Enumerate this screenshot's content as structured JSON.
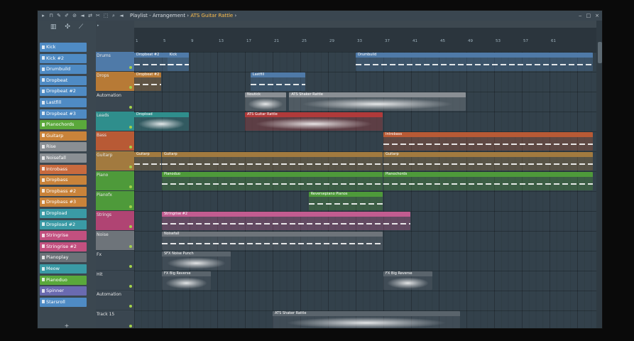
{
  "titlebar": {
    "title_prefix": "Playlist - Arrangement",
    "sep": "›",
    "current_pattern": "ATS Guitar Rattle",
    "min": "‒",
    "max": "□",
    "close": "×"
  },
  "browser": {
    "patterns": [
      {
        "label": "Kick",
        "color": "#4f8bc4"
      },
      {
        "label": "Kick #2",
        "color": "#4f8bc4"
      },
      {
        "label": "Drumbuild",
        "color": "#4f8bc4"
      },
      {
        "label": "Dropbeat",
        "color": "#4f8bc4"
      },
      {
        "label": "Dropbeat #2",
        "color": "#4f8bc4"
      },
      {
        "label": "Lastfill",
        "color": "#4f8bc4"
      },
      {
        "label": "Dropbeat #3",
        "color": "#4f8bc4"
      },
      {
        "label": "Pianochords",
        "color": "#5aa83b"
      },
      {
        "label": "Guitarp",
        "color": "#c9833a"
      },
      {
        "label": "Rise",
        "color": "#8a8f94"
      },
      {
        "label": "Noisefall",
        "color": "#8a8f94"
      },
      {
        "label": "Introbass",
        "color": "#c86a3e"
      },
      {
        "label": "Dropbass",
        "color": "#c9833a"
      },
      {
        "label": "Dropbass #2",
        "color": "#c9833a"
      },
      {
        "label": "Dropbass #3",
        "color": "#c9833a"
      },
      {
        "label": "Dropload",
        "color": "#3a9aa5"
      },
      {
        "label": "Dropload #2",
        "color": "#3a9aa5"
      },
      {
        "label": "Stringrise",
        "color": "#c2507f"
      },
      {
        "label": "Stringrise #2",
        "color": "#c2507f"
      },
      {
        "label": "Pianoplay",
        "color": "#6b7278"
      },
      {
        "label": "Meow",
        "color": "#3a9aa5"
      },
      {
        "label": "Pianoduo",
        "color": "#5aa83b"
      },
      {
        "label": "Spinner",
        "color": "#6a6ab0"
      },
      {
        "label": "Starsroll",
        "color": "#4f8bc4"
      }
    ],
    "add_label": "+"
  },
  "tracks": [
    {
      "label": "Drums",
      "color": "#4f7aa8"
    },
    {
      "label": "Drops",
      "color": "#b77a36"
    },
    {
      "label": "Automation",
      "color": "#3a4650"
    },
    {
      "label": "Leads",
      "color": "#2f8e8c"
    },
    {
      "label": "Bass",
      "color": "#b85a35"
    },
    {
      "label": "Guitarp",
      "color": "#a27a3f"
    },
    {
      "label": "Piano",
      "color": "#4e9a3a"
    },
    {
      "label": "Pianofx",
      "color": "#4e9a3a"
    },
    {
      "label": "Strings",
      "color": "#b04473"
    },
    {
      "label": "Noise",
      "color": "#6e747a"
    },
    {
      "label": "Fx",
      "color": "#3a4650"
    },
    {
      "label": "Hit",
      "color": "#3a4650"
    },
    {
      "label": "Automation",
      "color": "#3a4650"
    },
    {
      "label": "Track 15",
      "color": "#3a4650"
    }
  ],
  "ruler_numbers": [
    "1",
    "5",
    "9",
    "13",
    "17",
    "21",
    "25",
    "29",
    "33",
    "37",
    "41",
    "45",
    "49",
    "53",
    "57",
    "61"
  ],
  "clips": [
    {
      "track": 0,
      "from": 0,
      "to": 2,
      "label": "Dropbeat #2",
      "color": "#4f7aa8",
      "kind": "notes"
    },
    {
      "track": 0,
      "from": 1.2,
      "to": 2,
      "label": "Kick",
      "color": "#4f7aa8",
      "kind": "notes"
    },
    {
      "track": 0,
      "from": 8,
      "to": 16.6,
      "label": "Drumbuild",
      "color": "#4f7aa8",
      "kind": "notes"
    },
    {
      "track": 1,
      "from": 0,
      "to": 1,
      "label": "Dropbeat #2",
      "color": "#b77a36",
      "kind": "notes"
    },
    {
      "track": 1,
      "from": 4.2,
      "to": 6.2,
      "label": "Lastfill",
      "color": "#4f7aa8",
      "kind": "notes"
    },
    {
      "track": 2,
      "from": 4,
      "to": 5.5,
      "label": "Noutick",
      "color": "#8a8f94",
      "kind": "wave"
    },
    {
      "track": 2,
      "from": 5.6,
      "to": 12,
      "label": "ATS Shaker Rattle",
      "color": "#8a8f94",
      "kind": "wave"
    },
    {
      "track": 3,
      "from": 0,
      "to": 2,
      "label": "Dropload",
      "color": "#2f8e8c",
      "kind": "wave"
    },
    {
      "track": 3,
      "from": 4,
      "to": 9,
      "label": "ATS Guitar Rattle",
      "color": "#b03a3a",
      "kind": "wave"
    },
    {
      "track": 4,
      "from": 9,
      "to": 16.6,
      "label": "Introbass",
      "color": "#b85a35",
      "kind": "notes"
    },
    {
      "track": 5,
      "from": 0,
      "to": 1,
      "label": "Guitarp",
      "color": "#a27a3f",
      "kind": "notes"
    },
    {
      "track": 5,
      "from": 1,
      "to": 9,
      "label": "Guitarp",
      "color": "#a27a3f",
      "kind": "notes"
    },
    {
      "track": 5,
      "from": 9,
      "to": 16.6,
      "label": "Guitarp",
      "color": "#a27a3f",
      "kind": "notes"
    },
    {
      "track": 6,
      "from": 1,
      "to": 9,
      "label": "Pianoduo",
      "color": "#4e9a3a",
      "kind": "notes"
    },
    {
      "track": 6,
      "from": 9,
      "to": 16.6,
      "label": "Pianochords",
      "color": "#4e9a3a",
      "kind": "notes"
    },
    {
      "track": 7,
      "from": 6.3,
      "to": 9,
      "label": "Reversepiano Pianos",
      "color": "#4e9a3a",
      "kind": "notes"
    },
    {
      "track": 8,
      "from": 1,
      "to": 10,
      "label": "Stringrise #2",
      "color": "#c25c90",
      "kind": "notes"
    },
    {
      "track": 9,
      "from": 1,
      "to": 9,
      "label": "Noisefall",
      "color": "#6e747a",
      "kind": "notes"
    },
    {
      "track": 10,
      "from": 1,
      "to": 3.5,
      "label": "SFX Noise Punch",
      "color": "#5a646c",
      "kind": "wave"
    },
    {
      "track": 11,
      "from": 1,
      "to": 2.8,
      "label": "FX Big Reverse",
      "color": "#5a646c",
      "kind": "wave"
    },
    {
      "track": 11,
      "from": 9,
      "to": 10.8,
      "label": "FX Big Reverse",
      "color": "#5a646c",
      "kind": "wave"
    },
    {
      "track": 13,
      "from": 5,
      "to": 11.8,
      "label": "ATS Shaker Rattle",
      "color": "#5a646c",
      "kind": "wave"
    }
  ]
}
